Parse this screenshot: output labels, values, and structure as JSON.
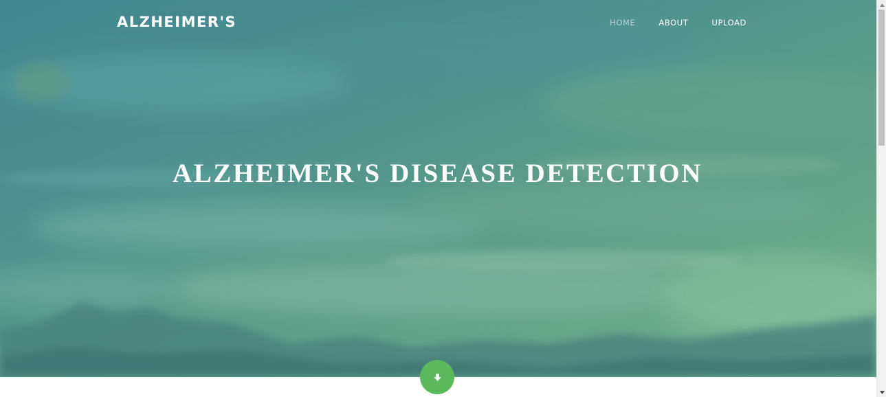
{
  "navbar": {
    "brand": "ALZHEIMER'S",
    "links": [
      {
        "label": "HOME",
        "active": true
      },
      {
        "label": "ABOUT",
        "active": false
      },
      {
        "label": "UPLOAD",
        "active": false
      }
    ]
  },
  "hero": {
    "title": "ALZHEIMER'S DISEASE DETECTION"
  },
  "scroll_button": {
    "icon": "arrow-down-icon",
    "color": "#5cb85c"
  },
  "colors": {
    "hero_overlay": "#4f9490",
    "nav_active": "#b8d1cf",
    "text": "#ffffff"
  }
}
